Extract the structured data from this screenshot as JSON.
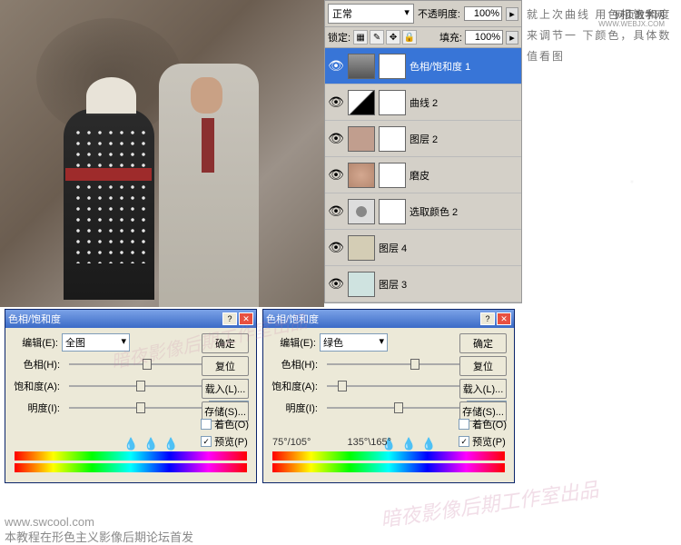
{
  "top_controls": {
    "blend_mode": "正常",
    "opacity_label": "不透明度:",
    "opacity_value": "100%",
    "lock_label": "锁定:",
    "fill_label": "填充:",
    "fill_value": "100%"
  },
  "layers": [
    {
      "name": "色相/饱和度 1",
      "thumb": "grad",
      "selected": true,
      "mask": true
    },
    {
      "name": "曲线 2",
      "thumb": "curves",
      "mask": true
    },
    {
      "name": "图层 2",
      "thumb": "fill1",
      "mask": true
    },
    {
      "name": "磨皮",
      "thumb": "skin",
      "mask": true
    },
    {
      "name": "选取颜色 2",
      "thumb": "sel-color",
      "mask": true
    },
    {
      "name": "图层 4",
      "thumb": "beige",
      "mask": false
    },
    {
      "name": "图层 3",
      "thumb": "ltblue",
      "mask": false
    }
  ],
  "right_text": "就上次曲线\n用色相饱和度来调节一\n下颜色，具体数值看图",
  "logo": {
    "main": "网页教学网",
    "sub": "WWW.WEBJX.COM"
  },
  "dialog_common": {
    "title": "色相/饱和度",
    "edit_label": "编辑(E):",
    "hue_label": "色相(H):",
    "sat_label": "饱和度(A):",
    "light_label": "明度(I):",
    "ok": "确定",
    "cancel": "复位",
    "load": "载入(L)...",
    "save": "存储(S)...",
    "colorize": "着色(O)",
    "preview": "预览(P)"
  },
  "dialog1": {
    "edit_value": "全图",
    "hue": "+9",
    "sat": "0",
    "light": "0"
  },
  "dialog2": {
    "edit_value": "绿色",
    "hue": "+37",
    "sat": "-88",
    "light": "0",
    "angle1": "75°/105°",
    "angle2": "135°\\165°"
  },
  "footer": {
    "url": "www.swcool.com",
    "text": "本教程在形色主义影像后期论坛首发"
  },
  "watermark": "暗夜影像后期工作室出品"
}
